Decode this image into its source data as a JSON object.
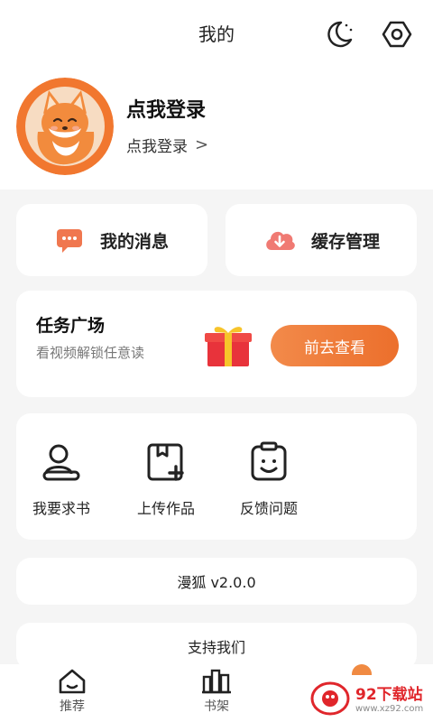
{
  "header": {
    "title": "我的"
  },
  "icons": {
    "moon": "moon-icon",
    "gear": "gear-icon"
  },
  "profile": {
    "title": "点我登录",
    "subtitle": "点我登录",
    "chevron": ">"
  },
  "quick_actions": [
    {
      "label": "我的消息",
      "icon": "message-icon",
      "color": "#f0774f"
    },
    {
      "label": "缓存管理",
      "icon": "cloud-download-icon",
      "color": "#f07a73"
    }
  ],
  "task": {
    "title": "任务广场",
    "subtitle": "看视频解锁任意读",
    "button": "前去查看",
    "accent": "#ef7a3a"
  },
  "tools": [
    {
      "label": "我要求书",
      "icon": "person-book-icon"
    },
    {
      "label": "上传作品",
      "icon": "upload-icon"
    },
    {
      "label": "反馈问题",
      "icon": "feedback-icon"
    }
  ],
  "version": {
    "text": "漫狐 v2.0.0"
  },
  "support": {
    "text": "支持我们"
  },
  "bottom_nav": [
    {
      "label": "推荐",
      "icon": "home-icon"
    },
    {
      "label": "书架",
      "icon": "bookshelf-icon"
    }
  ],
  "watermark": {
    "main": "92下载站",
    "url": "www.xz92.com"
  }
}
